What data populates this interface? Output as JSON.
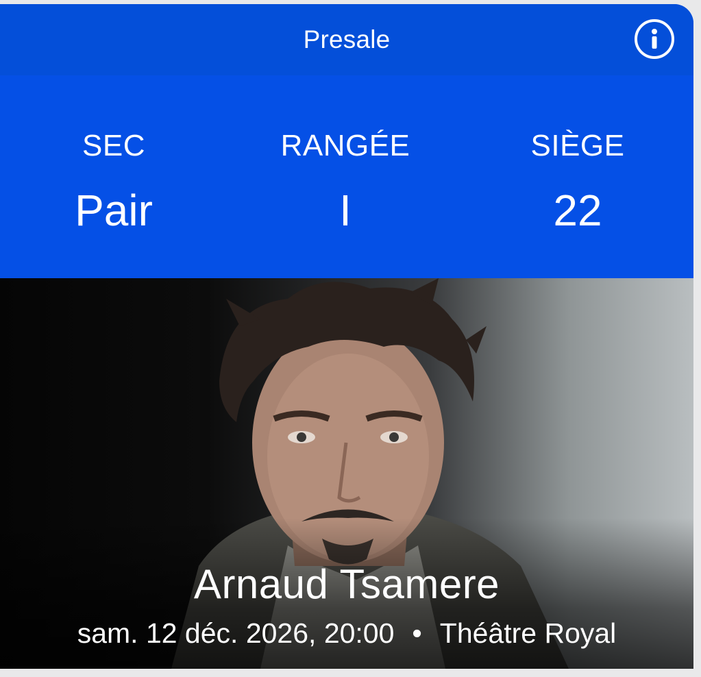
{
  "header": {
    "title": "Presale",
    "info_icon": "info-icon"
  },
  "seating": {
    "section_label": "SEC",
    "section_value": "Pair",
    "row_label": "RANGÉE",
    "row_value": "I",
    "seat_label": "SIÈGE",
    "seat_value": "22"
  },
  "event": {
    "performer": "Arnaud Tsamere",
    "datetime": "sam. 12 déc. 2026, 20:00",
    "separator": "•",
    "venue": "Théâtre Royal"
  },
  "colors": {
    "header_blue": "#044fd9",
    "panel_blue": "#0550e6",
    "text": "#ffffff"
  }
}
